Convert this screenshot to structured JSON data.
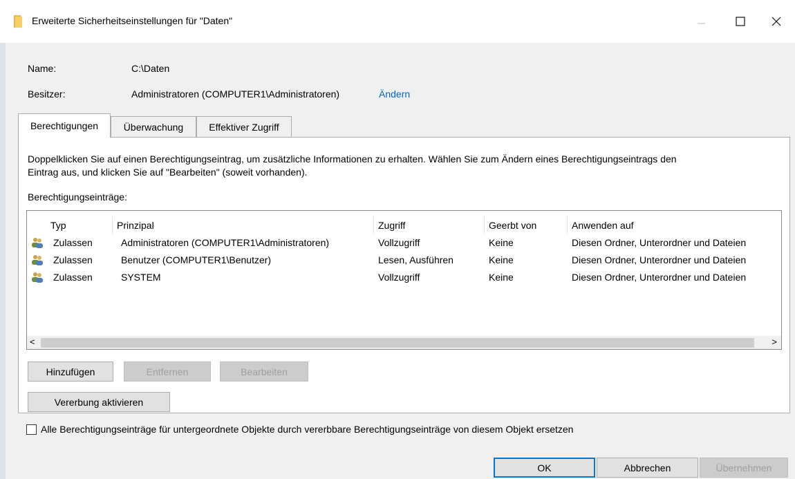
{
  "window": {
    "title": "Erweiterte Sicherheitseinstellungen für \"Daten\""
  },
  "info": {
    "name_label": "Name:",
    "name_value": "C:\\Daten",
    "owner_label": "Besitzer:",
    "owner_value": "Administratoren (COMPUTER1\\Administratoren)",
    "change_link": "Ändern"
  },
  "tabs": [
    {
      "label": "Berechtigungen",
      "active": true
    },
    {
      "label": "Überwachung",
      "active": false
    },
    {
      "label": "Effektiver Zugriff",
      "active": false
    }
  ],
  "panel": {
    "description_line1": "Doppelklicken Sie auf einen Berechtigungseintrag, um zusätzliche Informationen zu erhalten. Wählen Sie zum Ändern eines Berechtigungseintrags den",
    "description_line2": "Eintrag aus, und klicken Sie auf \"Bearbeiten\" (soweit vorhanden).",
    "entries_label": "Berechtigungseinträge:"
  },
  "table": {
    "columns": [
      "Typ",
      "Prinzipal",
      "Zugriff",
      "Geerbt von",
      "Anwenden auf"
    ],
    "rows": [
      {
        "icon": "users-icon",
        "type": "Zulassen",
        "principal": "Administratoren (COMPUTER1\\Administratoren)",
        "access": "Vollzugriff",
        "inherited": "Keine",
        "applies": "Diesen Ordner, Unterordner und Dateien"
      },
      {
        "icon": "users-icon",
        "type": "Zulassen",
        "principal": "Benutzer (COMPUTER1\\Benutzer)",
        "access": "Lesen, Ausführen",
        "inherited": "Keine",
        "applies": "Diesen Ordner, Unterordner und Dateien"
      },
      {
        "icon": "users-icon",
        "type": "Zulassen",
        "principal": "SYSTEM",
        "access": "Vollzugriff",
        "inherited": "Keine",
        "applies": "Diesen Ordner, Unterordner und Dateien"
      }
    ],
    "scroll_left": "<",
    "scroll_right": ">"
  },
  "buttons": {
    "add": "Hinzufügen",
    "remove": "Entfernen",
    "edit": "Bearbeiten",
    "enable_inheritance": "Vererbung aktivieren",
    "ok": "OK",
    "cancel": "Abbrechen",
    "apply": "Übernehmen"
  },
  "replace_checkbox": {
    "label": "Alle Berechtigungseinträge für untergeordnete Objekte durch vererbbare Berechtigungseinträge von diesem Objekt ersetzen",
    "checked": false
  },
  "colors": {
    "accent": "#0078d7",
    "link": "#0066cc",
    "dialog_bg": "#f0f0f0"
  }
}
